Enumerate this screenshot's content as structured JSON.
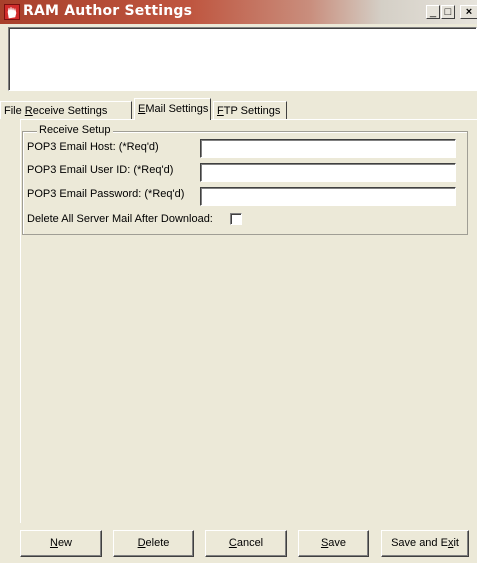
{
  "window": {
    "title": "RAM Author Settings",
    "controls": {
      "minimize": "_",
      "maximize": "□",
      "close": "×"
    }
  },
  "tabs": [
    {
      "prefix": "File ",
      "accel": "R",
      "suffix": "eceive Settings",
      "active": false
    },
    {
      "prefix": "",
      "accel": "E",
      "suffix": "Mail Settings",
      "active": true
    },
    {
      "prefix": "",
      "accel": "F",
      "suffix": "TP Settings",
      "active": false
    }
  ],
  "receive_setup": {
    "legend": "Receive Setup",
    "fields": [
      {
        "label": "POP3 Email Host: (*Req'd)",
        "value": ""
      },
      {
        "label": "POP3 Email User ID: (*Req'd)",
        "value": ""
      },
      {
        "label": "POP3 Email Password: (*Req'd)",
        "value": ""
      }
    ],
    "delete_mail_label": "Delete All Server Mail After Download:",
    "delete_mail_checked": false
  },
  "buttons": [
    {
      "accel": "N",
      "rest": "ew",
      "pre": ""
    },
    {
      "accel": "D",
      "rest": "elete",
      "pre": ""
    },
    {
      "accel": "C",
      "rest": "ancel",
      "pre": ""
    },
    {
      "accel": "S",
      "rest": "ave",
      "pre": ""
    },
    {
      "pre": "Save and E",
      "accel": "x",
      "rest": "it"
    }
  ]
}
